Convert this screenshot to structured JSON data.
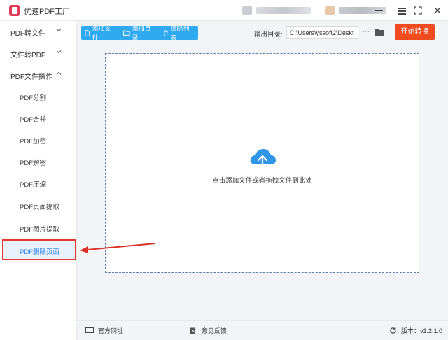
{
  "app": {
    "title": "优速PDF工厂"
  },
  "sidebar": {
    "groups": [
      {
        "label": "PDF转文件"
      },
      {
        "label": "文件转PDF"
      },
      {
        "label": "PDF文件操作"
      }
    ],
    "items": [
      {
        "label": "PDF分割"
      },
      {
        "label": "PDF合并"
      },
      {
        "label": "PDF加密"
      },
      {
        "label": "PDF解密"
      },
      {
        "label": "PDF压缩"
      },
      {
        "label": "PDF页面提取"
      },
      {
        "label": "PDF图片提取"
      },
      {
        "label": "PDF删除页面",
        "active": true
      }
    ]
  },
  "toolbar": {
    "add_file": "添加文件",
    "add_dir": "添加目录",
    "clear_list": "清除列表",
    "output_label": "输出目录:",
    "output_path": "C:\\Users\\yssoft2\\Deskt",
    "more": "···",
    "start": "开始转换"
  },
  "dropzone": {
    "hint": "点击添加文件或者拖拽文件到此处"
  },
  "footer": {
    "website": "官方网址",
    "feedback": "意见反馈",
    "version": "版本：v1.2.1.0"
  },
  "colors": {
    "accent": "#2fa9f0",
    "start": "#f04a1e",
    "highlight": "#e03a2e",
    "active_text": "#2f80ed"
  },
  "icons": [
    "app-logo",
    "menu-icon",
    "minimize-icon",
    "maximize-icon",
    "close-icon",
    "chevron-down-icon",
    "chevron-up-icon",
    "file-icon",
    "folder-icon",
    "trash-icon",
    "cloud-upload-icon",
    "monitor-icon",
    "feedback-icon",
    "refresh-icon"
  ]
}
